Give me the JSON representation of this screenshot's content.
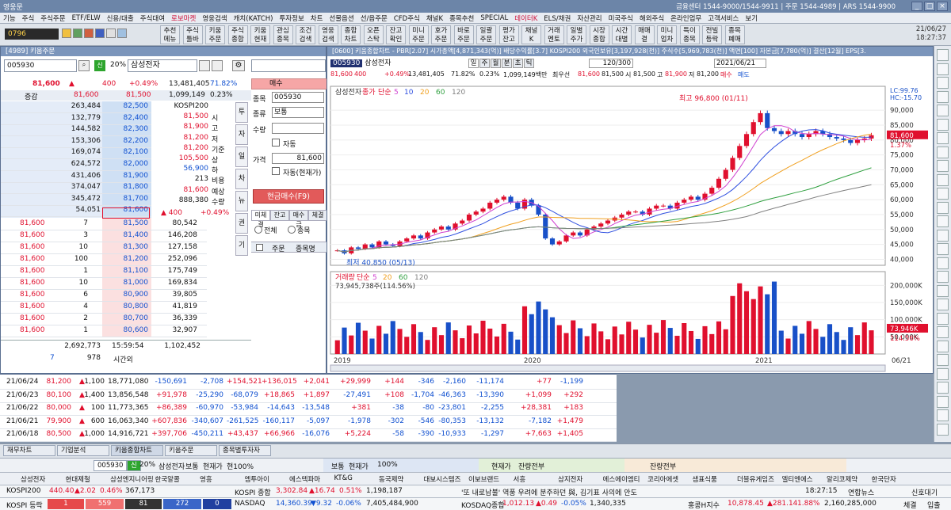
{
  "window": {
    "title": "영웅문",
    "info": "금융센터 1544-9000/1544-9911  |  주문 1544-4989  |  ARS 1544-9900"
  },
  "menu": [
    "기능",
    "주식",
    "주식주문",
    "ETF/ELW",
    "신용/대출",
    "주식대여",
    "로보마켓",
    "영웅검색",
    "캐치(KATCH)",
    "투자정보",
    "차트",
    "선물옵션",
    "선/옵주문",
    "CFD주식",
    "채널K",
    "종목추천",
    "SPECIAL",
    "데이터K",
    "ELS/채권",
    "자산관리",
    "미국주식",
    "해외주식",
    "온라인업무",
    "고객서비스",
    "보기"
  ],
  "toolbar": {
    "code": "0796",
    "buttons": [
      "추천\n메뉴",
      "주식\n툴바",
      "키움\n주문",
      "주식\n종합",
      "키움\n현재",
      "관심\n종목",
      "조건\n검색",
      "영웅\n검색",
      "종합\n차트",
      "오픈\n스탁",
      "잔고\n확인",
      "미니\n주문",
      "호가\n주문",
      "바로\n주문",
      "일괄\n주문",
      "평가\n잔고",
      "채널\nK",
      "거래\n멘토",
      "일별\n주가",
      "시장\n종합",
      "시간\n대별",
      "매매\n결",
      "미니\n업차",
      "특이\n종목",
      "전빌\n등락",
      "종목\n폐매"
    ],
    "date": "21/06/27",
    "time": "18:27:37"
  },
  "order": {
    "panel_title": "[4989] 키움주문",
    "code": "005930",
    "rate_label": "20%",
    "name": "삼성전자",
    "price": "81,600",
    "change": "400",
    "change_pct": "+0.49%",
    "volume": "13,481,405",
    "vol_pct": "71.82%",
    "summary_left": "증감",
    "summary_price": "81,600",
    "summary_price2": "81,500",
    "summary_vol": "1,099,149",
    "summary_pct": "0.23%",
    "asks": [
      [
        "263,484",
        "82,500"
      ],
      [
        "132,779",
        "82,400"
      ],
      [
        "144,582",
        "82,300"
      ],
      [
        "153,306",
        "82,200"
      ],
      [
        "169,074",
        "82,100"
      ],
      [
        "624,572",
        "82,000"
      ],
      [
        "431,406",
        "81,900"
      ],
      [
        "374,047",
        "81,800"
      ],
      [
        "345,472",
        "81,700"
      ],
      [
        "54,051",
        "81,600"
      ]
    ],
    "bids": [
      [
        "81,500",
        "80,542"
      ],
      [
        "81,400",
        "146,208"
      ],
      [
        "81,300",
        "127,158"
      ],
      [
        "81,200",
        "252,096"
      ],
      [
        "81,100",
        "175,749"
      ],
      [
        "81,000",
        "169,834"
      ],
      [
        "80,900",
        "39,805"
      ],
      [
        "80,800",
        "41,819"
      ],
      [
        "80,700",
        "36,339"
      ],
      [
        "80,600",
        "32,907"
      ]
    ],
    "ticks": [
      [
        "81,600",
        "7"
      ],
      [
        "81,600",
        "3"
      ],
      [
        "81,600",
        "10"
      ],
      [
        "81,600",
        "100"
      ],
      [
        "81,600",
        "1"
      ],
      [
        "81,600",
        "10"
      ],
      [
        "81,600",
        "6"
      ],
      [
        "81,600",
        "4"
      ],
      [
        "81,600",
        "2"
      ],
      [
        "81,600",
        "1"
      ]
    ],
    "info": [
      [
        "KOSPI200",
        ""
      ],
      [
        "81,500",
        "시"
      ],
      [
        "81,900",
        "고"
      ],
      [
        "81,200",
        "저"
      ],
      [
        "81,200",
        "기준"
      ],
      [
        "105,500",
        "상"
      ],
      [
        "56,900",
        "하"
      ],
      [
        "213",
        "비용"
      ],
      [
        "81,600",
        "예상"
      ],
      [
        "888,380",
        "수량"
      ]
    ],
    "info_bottom": [
      "400",
      "+0.49%"
    ],
    "totals": [
      "2,692,773",
      "15:59:54",
      "1,102,452"
    ],
    "totals2": [
      "7",
      "978",
      "시간외"
    ],
    "tabs": [
      "매수",
      "매도"
    ],
    "form": {
      "code_label": "종목",
      "code": "005930",
      "type_label": "종류",
      "type": "보통",
      "qty_label": "수량",
      "price_label": "가격",
      "price": "81,600",
      "auto": "자동",
      "auto2": "자동(현재가)",
      "submit": "현금매수(F9)"
    },
    "subtabs": [
      "미체결",
      "잔고",
      "매수금",
      "체결"
    ],
    "radio": [
      "전체",
      "종목"
    ],
    "grid_head": [
      "주문",
      "종목명"
    ],
    "side_tabs": [
      "투",
      "자",
      "일",
      "차",
      "뉴",
      "권",
      "기"
    ]
  },
  "chart": {
    "title": "[0600] 키움종합차트 - PBR[2.07] 시가총액[4,871,343(억)] 배당수익률[3.7] KOSPI200 외국인보유[3,197,928(천)] 주식수[5,969,783(천)] 액면[100] 자본금[7,780(억)] 결산[12월] EPS[3.",
    "code": "005930",
    "name": "삼성전자",
    "periods": [
      "일",
      "주",
      "월",
      "분",
      "초",
      "틱"
    ],
    "count": "120",
    "total": "/300",
    "date": "2021/06/21",
    "infobar": [
      "81,600",
      "400",
      "+0.49%",
      "13,481,405",
      "71.82%",
      "0.23%",
      "1,099,149백만",
      "최우선",
      "81,600",
      "81,500",
      "시",
      "81,500",
      "고",
      "81,900",
      "저",
      "81,200",
      "매수",
      "매도"
    ],
    "price_legend": [
      "삼성전자",
      "종가",
      "단순",
      "5",
      "10",
      "20",
      "60",
      "120"
    ],
    "volume_legend": [
      "거래량",
      "단순",
      "5",
      "20",
      "60",
      "120"
    ],
    "volume_info": "73,945,738주(114.56%)",
    "high_label": "최고 96,800 (01/11)",
    "low_label": "최저 40,850 (05/13)",
    "lc": "LC:99.76",
    "hc": "HC:-15.70",
    "last_price": "81,600",
    "last_pct": "1.37%",
    "last_vol": "73,946K",
    "last_vol_pct": "114.56%",
    "price_axis": [
      "90,000",
      "85,000",
      "80,000",
      "75,000",
      "70,000",
      "65,000",
      "60,000",
      "55,000",
      "50,000",
      "45,000",
      "40,000"
    ],
    "vol_axis": [
      "200,000K",
      "150,000K",
      "100,000K",
      "50,000K"
    ],
    "x_axis": [
      "2019",
      "2020",
      "2021",
      "06/21"
    ]
  },
  "daily": [
    [
      "21/06/24",
      "81,200",
      "1,100",
      "18,771,080",
      "-150,691",
      "-2,708",
      "+154,521",
      "+136,015",
      "+2,041",
      "+29,999",
      "+144",
      "-346",
      "-2,160",
      "-11,174",
      "+77",
      "-1,199"
    ],
    [
      "21/06/23",
      "80,100",
      "1,400",
      "13,856,548",
      "+91,978",
      "-25,290",
      "-68,079",
      "+18,865",
      "+1,897",
      "-27,491",
      "+108",
      "-1,704",
      "-46,363",
      "-13,390",
      "+1,099",
      "+292"
    ],
    [
      "21/06/22",
      "80,000",
      "100",
      "11,773,365",
      "+86,389",
      "-60,970",
      "-53,984",
      "-14,643",
      "-13,548",
      "+381",
      "-38",
      "-80",
      "-23,801",
      "-2,255",
      "+28,381",
      "+183"
    ],
    [
      "21/06/21",
      "79,900",
      "600",
      "16,063,340",
      "+607,836",
      "-340,607",
      "-261,525",
      "-160,117",
      "-5,097",
      "-1,978",
      "-302",
      "-546",
      "-80,353",
      "-13,132",
      "-7,182",
      "+1,479"
    ],
    [
      "21/06/18",
      "80,500",
      "1,000",
      "14,916,721",
      "+397,706",
      "-450,211",
      "+43,437",
      "+66,966",
      "-16,076",
      "+5,224",
      "-58",
      "-390",
      "-10,933",
      "-1,297",
      "+7,663",
      "+1,405"
    ]
  ],
  "tabs": [
    "재무차트",
    "기업분석",
    "키움종합차트",
    "키움주문",
    "종목별투자자"
  ],
  "bottom_order": {
    "code": "005930",
    "pct": "20%",
    "name": "삼성전자",
    "t1": "보통",
    "t2": "현재가",
    "t3": "현100%",
    "t4": "보통",
    "t5": "현재가",
    "t6": "100%",
    "t7": "현재가",
    "t8": "잔량전부",
    "t9": "잔량전부"
  },
  "stocks": [
    "삼성전자",
    "현대제철",
    "삼성엔지니어링",
    "한국알콜",
    "영흥",
    "엠투아이",
    "에스텍파마",
    "KT&G",
    "동국제약",
    "대보시스템즈",
    "이보브랜드",
    "서흥",
    "삼지전자",
    "에스에이엠티",
    "코리아에셋",
    "샘표식품",
    "더블유게임즈",
    "엘티엔에스",
    "알리코제약",
    "한국단자"
  ],
  "index1": {
    "a": "KOSPI200",
    "a_v": "440.40",
    "a_c": "▲2.02",
    "a_p": "0.46%",
    "a_vol": "367,173",
    "b": "KOSPI 종합",
    "b_v": "3,302.84",
    "b_c": "▲16.74",
    "b_p": "0.51%",
    "b_vol": "1,198,187",
    "news": "'또 내로남불' 역풍 우려에 분주하던 與, 김기표 사의에 안도",
    "time": "18:27:15",
    "news2": "연합뉴스",
    "rt": "신호대기"
  },
  "index2": {
    "a": "KOSPI 등락",
    "a_1": "1",
    "a_2": "559",
    "a_3": "81",
    "a_4": "272",
    "a_5": "0",
    "b": "NASDAQ",
    "b_v": "14,360.39",
    "b_c": "▼9.32",
    "b_p": "-0.06%",
    "b_vol": "7,405,484,900",
    "c": "KOSDAQ종합",
    "c_v": "1,012.13",
    "c_c": "▲0.49",
    "c_p": "-0.05%",
    "c_vol": "1,340,335",
    "d": "홍콩H지수",
    "d_v": "10,878.45",
    "d_c": "▲281.14",
    "d_p": "1.88%",
    "d_vol": "2,160,285,000",
    "st": "체결",
    "st2": "입출"
  },
  "chart_data": {
    "type": "candlestick+volume",
    "x": [
      "2019",
      "2020",
      "2021",
      "06/21"
    ],
    "ylim": [
      38000,
      98000
    ],
    "high": 96800,
    "low": 40850,
    "last": 81600,
    "close": [
      43000,
      42000,
      44000,
      43500,
      45000,
      44000,
      46000,
      45000,
      44500,
      46000,
      47000,
      48000,
      47000,
      49000,
      50000,
      51000,
      50000,
      52000,
      53000,
      55000,
      56000,
      57000,
      59000,
      60000,
      61000,
      59000,
      57000,
      60000,
      58000,
      55000,
      47000,
      45000,
      46000,
      48000,
      49000,
      48000,
      50000,
      51000,
      52000,
      53000,
      54000,
      55000,
      56000,
      56000,
      55000,
      57000,
      58000,
      58000,
      57000,
      59000,
      60000,
      61000,
      60000,
      62000,
      64000,
      67000,
      70000,
      74000,
      78000,
      82000,
      86000,
      89000,
      84000,
      83000,
      82000,
      83000,
      82000,
      81000,
      82000,
      83000,
      82000,
      81000,
      80500,
      80000,
      79000,
      80000,
      80500,
      81600
    ]
  }
}
